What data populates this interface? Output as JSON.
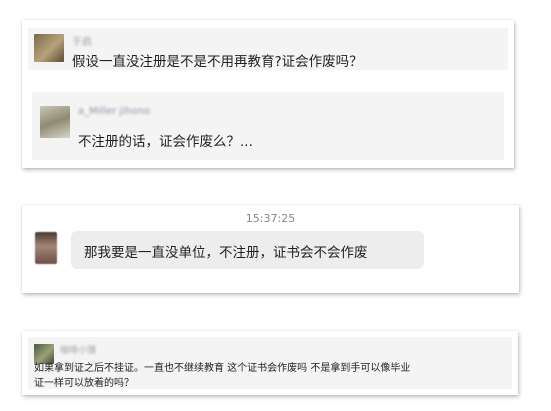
{
  "card1": {
    "username": "于启",
    "question": "假设一直没注册是不是不用再教育?证会作废吗？",
    "reply": {
      "username": "a_Miller jihono",
      "text": "不注册的话，证会作废么？..."
    }
  },
  "card2": {
    "timestamp": "15:37:25",
    "message": "那我要是一直没单位，不注册，证书会不会作废"
  },
  "card3": {
    "username": "咖啡小馒",
    "line1": "如果拿到证之后不挂证。一直也不继续教育 这个证书会作废吗 不是拿到手可以像毕业",
    "line2": "证一样可以放着的吗？"
  }
}
